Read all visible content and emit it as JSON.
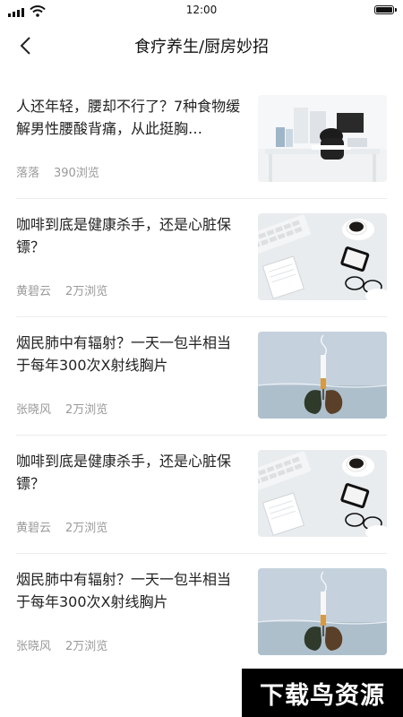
{
  "status_bar": {
    "time": "12:00"
  },
  "nav": {
    "title": "食疗养生/厨房妙招",
    "back_icon": "chevron-left-icon"
  },
  "articles": [
    {
      "title": "人还年轻，腰却不行了？7种食物缓解男性腰酸背痛，从此挺胸…",
      "author": "落落",
      "views": "390浏览",
      "thumb": "office-desk-photo"
    },
    {
      "title": "咖啡到底是健康杀手，还是心脏保镖？",
      "author": "黄碧云",
      "views": "2万浏览",
      "thumb": "coffee-desk-photo"
    },
    {
      "title": "烟民肺中有辐射？一天一包半相当于每年300次X射线胸片",
      "author": "张晓风",
      "views": "2万浏览",
      "thumb": "cigarette-lungs-photo"
    },
    {
      "title": "咖啡到底是健康杀手，还是心脏保镖？",
      "author": "黄碧云",
      "views": "2万浏览",
      "thumb": "coffee-desk-photo"
    },
    {
      "title": "烟民肺中有辐射？一天一包半相当于每年300次X射线胸片",
      "author": "张晓风",
      "views": "2万浏览",
      "thumb": "cigarette-lungs-photo"
    }
  ],
  "watermark": "下载鸟资源"
}
